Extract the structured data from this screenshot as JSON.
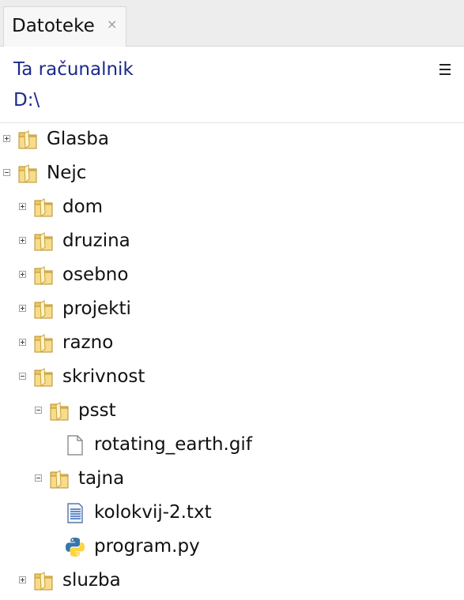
{
  "tab": {
    "label": "Datoteke",
    "close_glyph": "×"
  },
  "header": {
    "location": "Ta računalnik",
    "path": "D:\\",
    "menu_icon": "hamburger-menu-icon"
  },
  "tree": [
    {
      "label": "Glasba",
      "type": "folder",
      "depth": 0,
      "expanded": false
    },
    {
      "label": "Nejc",
      "type": "folder",
      "depth": 0,
      "expanded": true
    },
    {
      "label": "dom",
      "type": "folder",
      "depth": 1,
      "expanded": false
    },
    {
      "label": "druzina",
      "type": "folder",
      "depth": 1,
      "expanded": false
    },
    {
      "label": "osebno",
      "type": "folder",
      "depth": 1,
      "expanded": false
    },
    {
      "label": "projekti",
      "type": "folder",
      "depth": 1,
      "expanded": false
    },
    {
      "label": "razno",
      "type": "folder",
      "depth": 1,
      "expanded": false
    },
    {
      "label": "skrivnost",
      "type": "folder",
      "depth": 1,
      "expanded": true
    },
    {
      "label": "psst",
      "type": "folder",
      "depth": 2,
      "expanded": true
    },
    {
      "label": "rotating_earth.gif",
      "type": "file",
      "depth": 3
    },
    {
      "label": "tajna",
      "type": "folder",
      "depth": 2,
      "expanded": true
    },
    {
      "label": "kolokvij-2.txt",
      "type": "text",
      "depth": 3
    },
    {
      "label": "program.py",
      "type": "python",
      "depth": 3
    },
    {
      "label": "sluzba",
      "type": "folder",
      "depth": 1,
      "expanded": false
    }
  ],
  "colors": {
    "header_text": "#1a2a8c",
    "folder": "#f0c860",
    "python_blue": "#3776ab",
    "python_yellow": "#ffd43b"
  }
}
